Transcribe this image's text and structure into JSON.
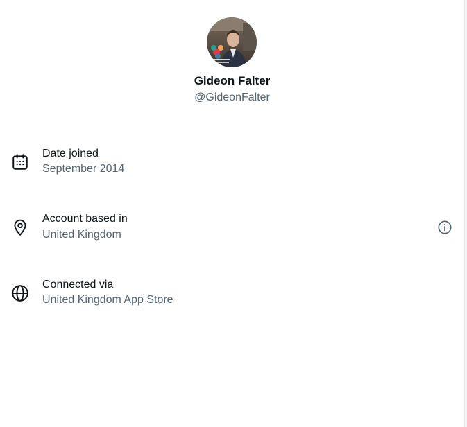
{
  "profile": {
    "display_name": "Gideon Falter",
    "handle": "@GideonFalter",
    "avatar_icon": "profile-photo"
  },
  "about": {
    "rows": [
      {
        "icon": "calendar-icon",
        "title": "Date joined",
        "value": "September 2014"
      },
      {
        "icon": "location-pin-icon",
        "title": "Account based in",
        "value": "United Kingdom",
        "info_icon": "info-icon"
      },
      {
        "icon": "globe-icon",
        "title": "Connected via",
        "value": "United Kingdom App Store"
      }
    ]
  },
  "colors": {
    "primary_text": "#0f1419",
    "secondary_text": "#536471",
    "background": "#ffffff"
  }
}
